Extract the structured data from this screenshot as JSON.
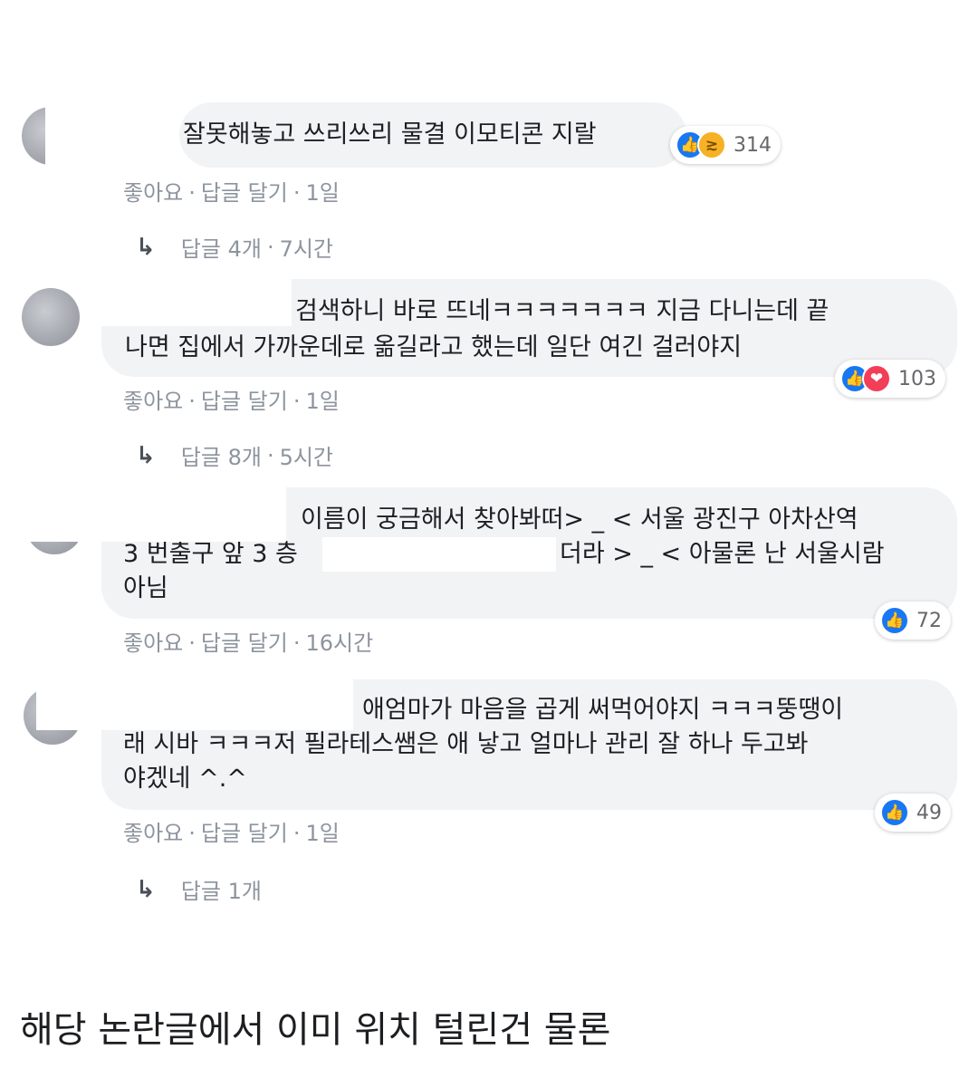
{
  "comments": [
    {
      "lines": [
        "잘못해놓고 쓰리쓰리 물결 이모티콘 지랄"
      ],
      "reaction_icons": [
        "like-icon",
        "haha-icon"
      ],
      "reaction_count": "314",
      "actions": {
        "like": "좋아요",
        "reply": "답글 달기",
        "time": "1일"
      },
      "replies": {
        "label": "답글 4개",
        "time": "7시간"
      }
    },
    {
      "lines": [
        "검색하니 바로 뜨네ㅋㅋㅋㅋㅋㅋㅋ 지금 다니는데 끝",
        "나면 집에서 가까운데로 옮길라고 했는데 일단 여긴 걸러야지"
      ],
      "reaction_icons": [
        "like-icon",
        "love-icon"
      ],
      "reaction_count": "103",
      "actions": {
        "like": "좋아요",
        "reply": "답글 달기",
        "time": "1일"
      },
      "replies": {
        "label": "답글 8개",
        "time": "5시간"
      }
    },
    {
      "lines": [
        "이름이 궁금해서 찾아봐떠> _ < 서울 광진구 아차산역",
        "3 번출구 앞 3 층",
        "더라 > _ < 아물론 난 서울시람",
        "아님"
      ],
      "reaction_icons": [
        "like-icon"
      ],
      "reaction_count": "72",
      "actions": {
        "like": "좋아요",
        "reply": "답글 달기",
        "time": "16시간"
      }
    },
    {
      "lines": [
        "애엄마가 마음을 곱게 써먹어야지 ㅋㅋㅋ뚱땡이",
        "래 시바 ㅋㅋㅋ저 필라테스쌤은 애 낳고 얼마나 관리 잘 하나 두고봐",
        "야겠네 ^.^"
      ],
      "reaction_icons": [
        "like-icon"
      ],
      "reaction_count": "49",
      "actions": {
        "like": "좋아요",
        "reply": "답글 달기",
        "time": "1일"
      },
      "replies": {
        "label": "답글 1개"
      }
    }
  ],
  "separator": "·",
  "caption": "해당 논란글에서 이미 위치 털린건 물론"
}
